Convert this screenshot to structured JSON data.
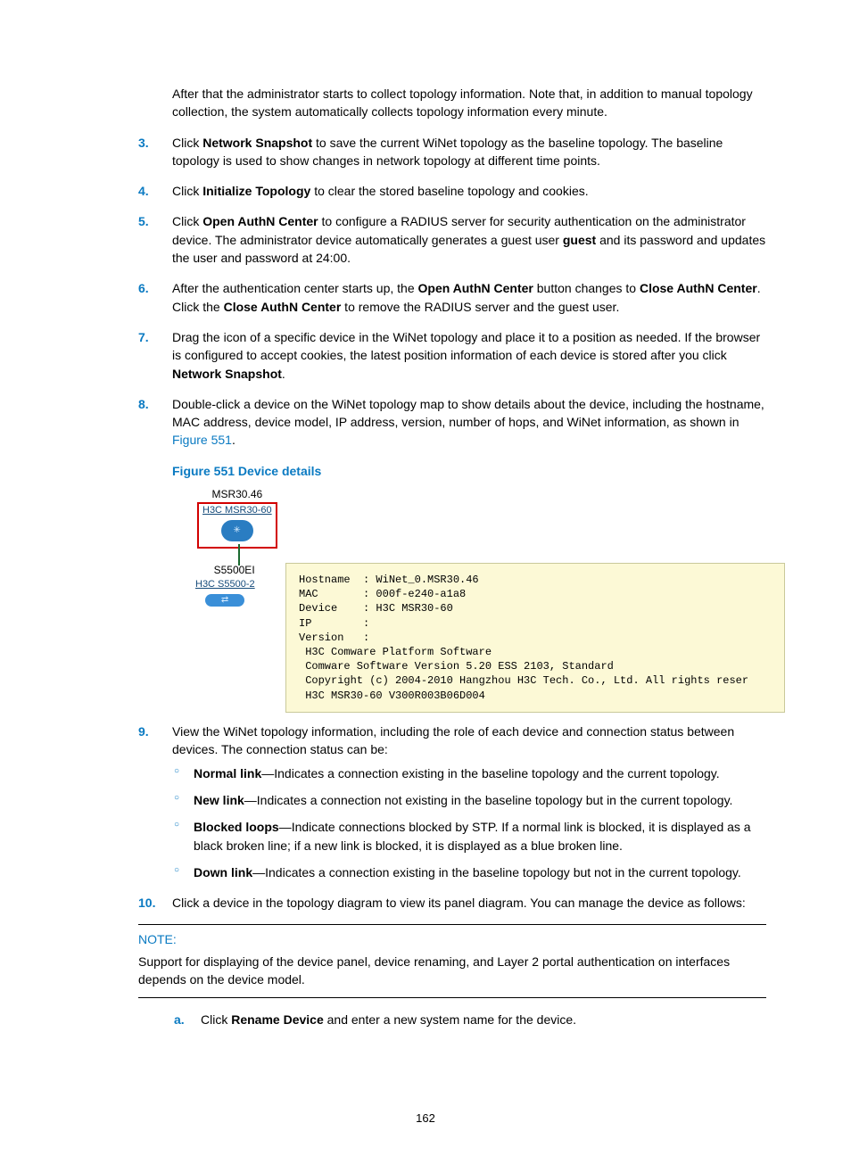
{
  "intro": "After that the administrator starts to collect topology information. Note that, in addition to manual topology collection, the system automatically collects topology information every minute.",
  "steps": {
    "s3": {
      "num": "3.",
      "t1": "Click ",
      "b1": "Network Snapshot",
      "t2": " to save the current WiNet topology as the baseline topology. The baseline topology is used to show changes in network topology at different time points."
    },
    "s4": {
      "num": "4.",
      "t1": "Click ",
      "b1": "Initialize Topology",
      "t2": " to clear the stored baseline topology and cookies."
    },
    "s5": {
      "num": "5.",
      "t1": "Click ",
      "b1": "Open AuthN Center",
      "t2": " to configure a RADIUS server for security authentication on the administrator device. The administrator device automatically generates a guest user ",
      "b2": "guest",
      "t3": " and its password and updates the user and password at 24:00."
    },
    "s6": {
      "num": "6.",
      "t1": "After the authentication center starts up, the ",
      "b1": "Open AuthN Center",
      "t2": " button changes to ",
      "b2": "Close AuthN Center",
      "t3": ". Click the ",
      "b3": "Close AuthN Center",
      "t4": " to remove the RADIUS server and the guest user."
    },
    "s7": {
      "num": "7.",
      "t1": "Drag the icon of a specific device in the WiNet topology and place it to a position as needed. If the browser is configured to accept cookies, the latest position information of each device is stored after you click ",
      "b1": "Network Snapshot",
      "t2": "."
    },
    "s8": {
      "num": "8.",
      "t1": "Double-click a device on the WiNet topology map to show details about the device, including the hostname, MAC address, device model, IP address, version, number of hops, and WiNet information, as shown in ",
      "l1": "Figure 551",
      "t2": "."
    },
    "s9": {
      "num": "9.",
      "t1": "View the WiNet topology information, including the role of each device and connection status between devices. The connection status can be:"
    },
    "s10": {
      "num": "10.",
      "t1": "Click a device in the topology diagram to view its panel diagram. You can manage the device as follows:"
    }
  },
  "bullets": {
    "b1": {
      "head": "Normal link",
      "tail": "—Indicates a connection existing in the baseline topology and the current topology."
    },
    "b2": {
      "head": "New link",
      "tail": "—Indicates a connection not existing in the baseline topology but in the current topology."
    },
    "b3": {
      "head": "Blocked loops",
      "tail": "—Indicate connections blocked by STP. If a normal link is blocked, it is displayed as a black broken line; if a new link is blocked, it is displayed as a blue broken line."
    },
    "b4": {
      "head": "Down link",
      "tail": "—Indicates a connection existing in the baseline topology but not in the current topology."
    }
  },
  "figure": {
    "caption": "Figure 551 Device details",
    "dev1": {
      "name": "MSR30.46",
      "model": "H3C MSR30-60"
    },
    "dev2": {
      "name": "S5500EI",
      "model": "H3C S5500-2"
    },
    "tooltip": "Hostname  : WiNet_0.MSR30.46\nMAC       : 000f-e240-a1a8\nDevice    : H3C MSR30-60\nIP        :\nVersion   :\n H3C Comware Platform Software\n Comware Software Version 5.20 ESS 2103, Standard\n Copyright (c) 2004-2010 Hangzhou H3C Tech. Co., Ltd. All rights reser\n H3C MSR30-60 V300R003B06D004"
  },
  "note": {
    "label": "NOTE:",
    "body": "Support for displaying of the device panel, device renaming, and Layer 2 portal authentication on interfaces depends on the device model."
  },
  "sub": {
    "a": {
      "al": "a.",
      "t1": "Click ",
      "b1": "Rename Device",
      "t2": " and enter a new system name for the device."
    }
  },
  "pagenum": "162"
}
